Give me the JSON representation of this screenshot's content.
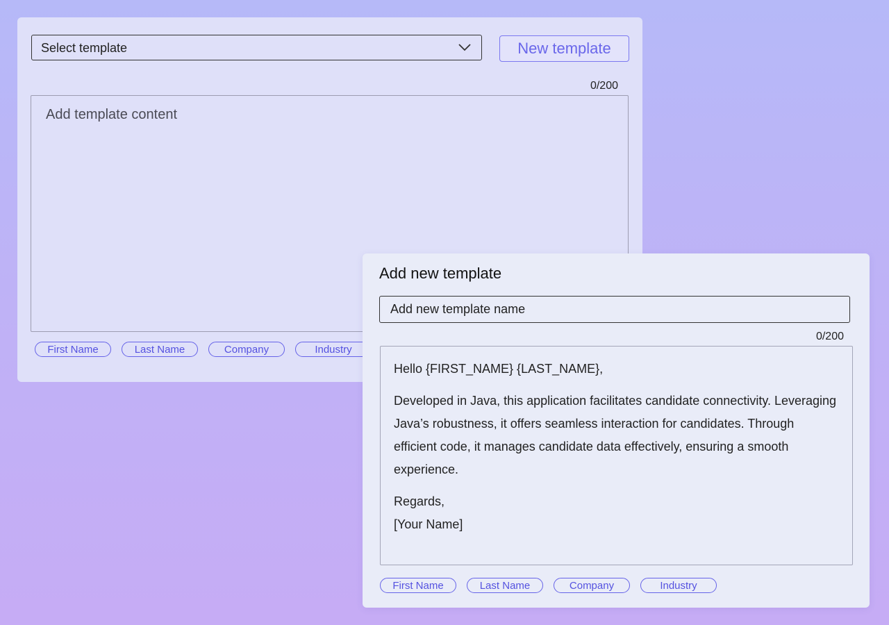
{
  "template_editor": {
    "select_placeholder": "Select template",
    "new_template_button": "New template",
    "char_counter": "0/200",
    "content_placeholder": "Add template content",
    "chips": [
      "First Name",
      "Last Name",
      "Company",
      "Industry"
    ]
  },
  "new_template_dialog": {
    "title": "Add new template",
    "name_placeholder": "Add new template name",
    "char_counter": "0/200",
    "content": {
      "greeting": "Hello {FIRST_NAME} {LAST_NAME},",
      "body": "Developed in Java, this application facilitates candidate connectivity. Leveraging Java’s robustness, it offers seamless interaction for candidates. Through efficient code, it manages candidate data effectively, ensuring a smooth experience.",
      "closing": "Regards,",
      "signature": "[Your Name]"
    },
    "chips": [
      "First Name",
      "Last Name",
      "Company",
      "Industry"
    ]
  },
  "colors": {
    "accent": "#6a67ea",
    "background_top": "#b6b9f8",
    "background_bottom": "#c6acf5",
    "panel_back": "#dfe0f9",
    "panel_front": "#e9ecf8"
  }
}
